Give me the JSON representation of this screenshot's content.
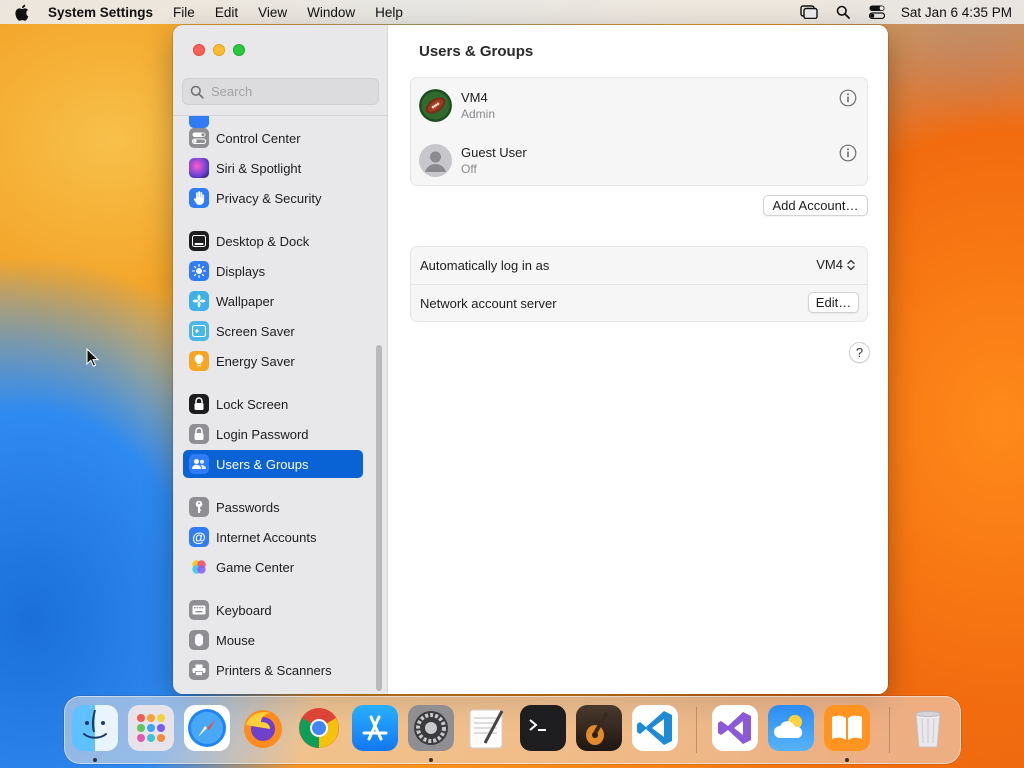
{
  "menubar": {
    "app_name": "System Settings",
    "menus": [
      "File",
      "Edit",
      "View",
      "Window",
      "Help"
    ],
    "datetime": "Sat Jan 6  4:35 PM"
  },
  "sidebar": {
    "search_placeholder": "Search",
    "items": [
      {
        "label": "Control Center",
        "icon": "control-center-icon",
        "color": "#8e8e93"
      },
      {
        "label": "Siri & Spotlight",
        "icon": "siri-icon",
        "color": "#6a3fd6"
      },
      {
        "label": "Privacy & Security",
        "icon": "hand-icon",
        "color": "#2f7cf6"
      },
      {
        "label": "Desktop & Dock",
        "icon": "dock-icon",
        "color": "#1c1c1e"
      },
      {
        "label": "Displays",
        "icon": "sun-icon",
        "color": "#2f7cf6"
      },
      {
        "label": "Wallpaper",
        "icon": "wallpaper-icon",
        "color": "#3fb0e8"
      },
      {
        "label": "Screen Saver",
        "icon": "screensaver-icon",
        "color": "#4ab7e6"
      },
      {
        "label": "Energy Saver",
        "icon": "bulb-icon",
        "color": "#f5a623"
      },
      {
        "label": "Lock Screen",
        "icon": "lock-icon",
        "color": "#1c1c1e"
      },
      {
        "label": "Login Password",
        "icon": "lock-icon",
        "color": "#8e8e93"
      },
      {
        "label": "Users & Groups",
        "icon": "users-icon",
        "color": "#2f7cf6"
      },
      {
        "label": "Passwords",
        "icon": "key-icon",
        "color": "#8e8e93"
      },
      {
        "label": "Internet Accounts",
        "icon": "at-icon",
        "color": "#2f7cf6"
      },
      {
        "label": "Game Center",
        "icon": "game-center-icon",
        "color": "#ffffff"
      },
      {
        "label": "Keyboard",
        "icon": "keyboard-icon",
        "color": "#8e8e93"
      },
      {
        "label": "Mouse",
        "icon": "mouse-icon",
        "color": "#8e8e93"
      },
      {
        "label": "Printers & Scanners",
        "icon": "printer-icon",
        "color": "#8e8e93"
      }
    ],
    "selected": "Users & Groups"
  },
  "main": {
    "title": "Users & Groups",
    "users": [
      {
        "name": "VM4",
        "role": "Admin"
      },
      {
        "name": "Guest User",
        "role": "Off"
      }
    ],
    "add_account_label": "Add Account…",
    "auto_login_label": "Automatically log in as",
    "auto_login_value": "VM4",
    "network_server_label": "Network account server",
    "edit_label": "Edit…",
    "help_label": "?"
  },
  "dock": {
    "apps": [
      "Finder",
      "Launchpad",
      "Safari",
      "Firefox",
      "Chrome",
      "App Store",
      "System Settings",
      "TextEdit",
      "Terminal",
      "GarageBand",
      "Visual Studio Code",
      "Visual Studio",
      "Weather",
      "Books",
      "Trash"
    ]
  }
}
